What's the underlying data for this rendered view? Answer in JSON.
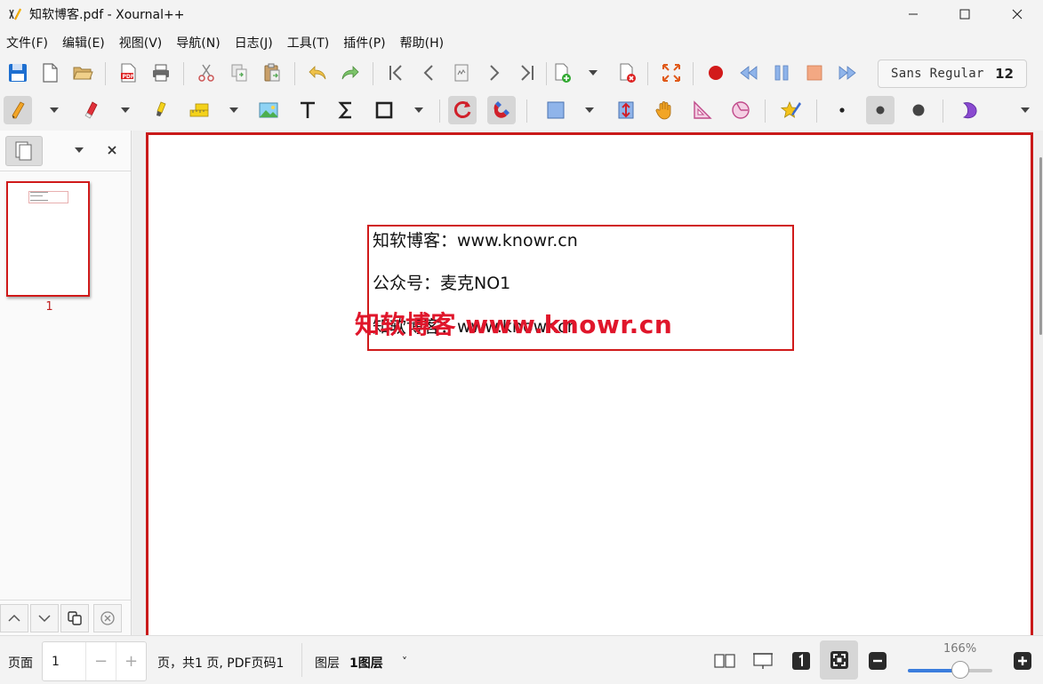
{
  "window": {
    "title": "知软博客.pdf - Xournal++",
    "app_icon": "xournal-icon"
  },
  "menu": [
    "文件(F)",
    "编辑(E)",
    "视图(V)",
    "导航(N)",
    "日志(J)",
    "工具(T)",
    "插件(P)",
    "帮助(H)"
  ],
  "toolbar": {
    "font_name": "Sans Regular",
    "font_size": "12"
  },
  "sidebar": {
    "page_number": "1"
  },
  "document": {
    "lines": [
      {
        "cjk": "知软博客：",
        "latin": "www.knowr.cn"
      },
      {
        "cjk": "公众号：麦克",
        "latin": "NO1"
      },
      {
        "cjk": "知软博客：",
        "latin": "www.knowr.cn"
      }
    ],
    "watermark": "知软博客 www.knowr.cn"
  },
  "status": {
    "page_label": "页面",
    "page_value": "1",
    "minus": "−",
    "plus": "+",
    "page_info": "页，共1 页, PDF页码1",
    "layer_label": "图层",
    "layer_value": "1图层",
    "layer_chevron": "˅",
    "zoom": "166%",
    "zoom_fraction": 0.62
  },
  "colors": {
    "accent_red": "#d01a1a",
    "watermark_red": "#e0162b",
    "slider_blue": "#3b7ddd"
  }
}
